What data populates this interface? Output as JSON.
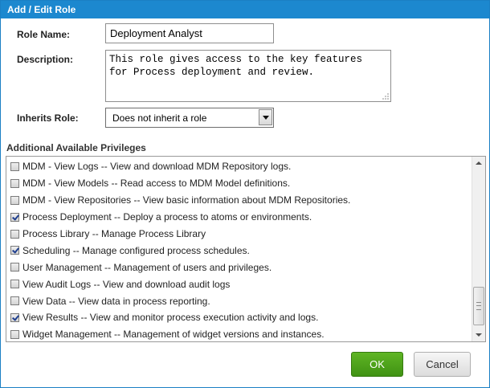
{
  "window": {
    "title": "Add / Edit Role"
  },
  "form": {
    "role_name_label": "Role Name:",
    "role_name_value": "Deployment Analyst",
    "description_label": "Description:",
    "description_value": "This role gives access to the key features\nfor Process deployment and review.",
    "inherits_label": "Inherits Role:",
    "inherits_value": "Does not inherit a role"
  },
  "privileges": {
    "title": "Additional Available Privileges",
    "items": [
      {
        "label": "MDM - View Logs -- View and download MDM Repository logs.",
        "checked": false
      },
      {
        "label": "MDM - View Models -- Read access to MDM Model definitions.",
        "checked": false
      },
      {
        "label": "MDM - View Repositories -- View basic information about MDM Repositories.",
        "checked": false
      },
      {
        "label": "Process Deployment -- Deploy a process to atoms or environments.",
        "checked": true
      },
      {
        "label": "Process Library -- Manage Process Library",
        "checked": false
      },
      {
        "label": "Scheduling -- Manage configured process schedules.",
        "checked": true
      },
      {
        "label": "User Management -- Management of users and privileges.",
        "checked": false
      },
      {
        "label": "View Audit Logs -- View and download audit logs",
        "checked": false
      },
      {
        "label": "View Data -- View data in process reporting.",
        "checked": false
      },
      {
        "label": "View Results -- View and monitor process execution activity and logs.",
        "checked": true
      },
      {
        "label": "Widget Management -- Management of widget versions and instances.",
        "checked": false
      }
    ]
  },
  "buttons": {
    "ok_label": "OK",
    "cancel_label": "Cancel"
  },
  "icons": {
    "dropdown": "chevron-down-icon",
    "scroll_up": "arrow-up-icon",
    "scroll_down": "arrow-down-icon",
    "resize": "resize-grip-icon"
  },
  "colors": {
    "titlebar": "#1c88cf",
    "ok_button": "#4fa31b",
    "checkmark": "#1f3f8f"
  }
}
